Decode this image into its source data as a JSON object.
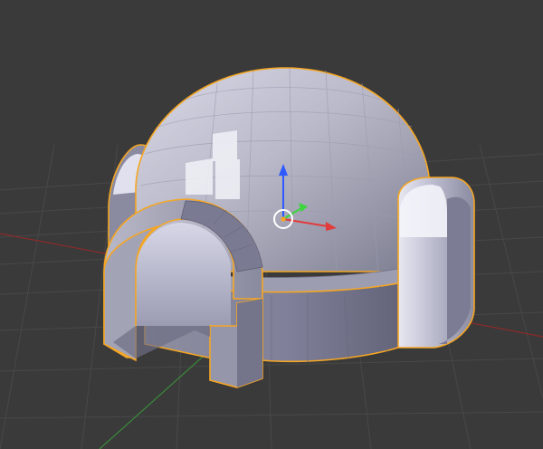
{
  "viewport": {
    "mode": "3d-viewport",
    "object": "igloo-mesh",
    "object_selected": true,
    "shading": "solid",
    "gizmo": "translate",
    "axes_shown": [
      "x-axis",
      "y-axis"
    ]
  },
  "colors": {
    "background": "#3a3a3a",
    "grid_line": "#4a4a4a",
    "axis_x": "#8c2a2a",
    "axis_y": "#3a8a3a",
    "selection_outline": "#f5a623",
    "mesh_light": "#dcdce8",
    "mesh_mid": "#9a9aab",
    "mesh_dark": "#6a6a7c",
    "gizmo_x": "#e23b3b",
    "gizmo_y": "#3bd63b",
    "gizmo_z": "#2d5bff"
  }
}
